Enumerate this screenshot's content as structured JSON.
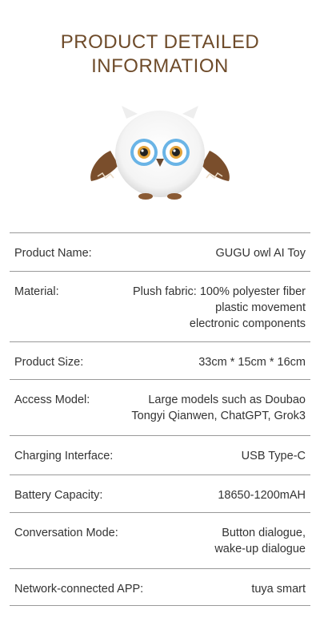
{
  "header": {
    "title_line1": "PRODUCT DETAILED",
    "title_line2": "INFORMATION"
  },
  "product_image": {
    "icon": "owl-plush-toy"
  },
  "specs": [
    {
      "label": "Product Name:",
      "values": [
        "GUGU owl AI Toy"
      ]
    },
    {
      "label": "Material:",
      "values": [
        "Plush fabric: 100% polyester fiber",
        "plastic movement",
        "electronic components"
      ]
    },
    {
      "label": "Product Size:",
      "values": [
        "33cm * 15cm * 16cm"
      ]
    },
    {
      "label": "Access Model:",
      "values": [
        "Large models such as Doubao",
        "Tongyi Qianwen, ChatGPT, Grok3"
      ]
    },
    {
      "label": "Charging Interface:",
      "values": [
        "USB Type-C"
      ]
    },
    {
      "label": "Battery Capacity:",
      "values": [
        "18650-1200mAH"
      ]
    },
    {
      "label": "Conversation Mode:",
      "values": [
        "Button dialogue,",
        "wake-up dialogue"
      ]
    },
    {
      "label": "Network-connected APP:",
      "values": [
        "tuya smart"
      ]
    }
  ],
  "colors": {
    "title": "#6e4b2a",
    "divider": "#9a9a9a",
    "text": "#333333"
  }
}
